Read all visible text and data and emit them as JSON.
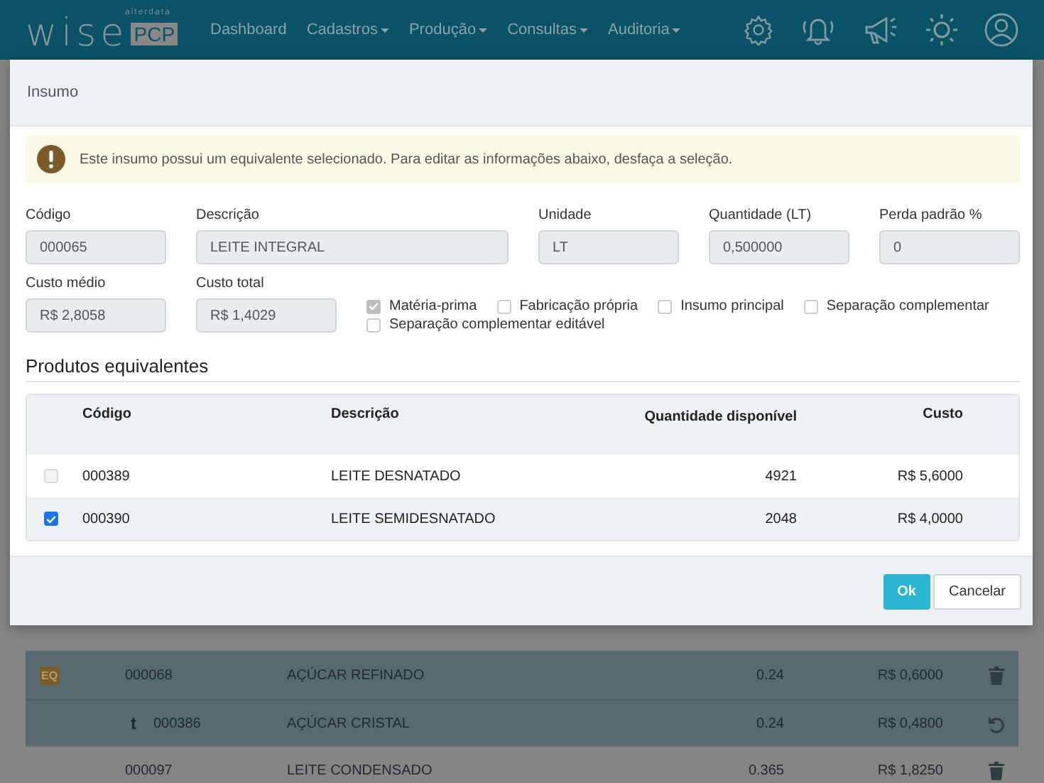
{
  "navbar": {
    "logo": "wise",
    "logo_badge": "PCP",
    "tagline": "alterdata",
    "menu": [
      {
        "label": "Dashboard",
        "dropdown": false
      },
      {
        "label": "Cadastros",
        "dropdown": true
      },
      {
        "label": "Produção",
        "dropdown": true
      },
      {
        "label": "Consultas",
        "dropdown": true
      },
      {
        "label": "Auditoria",
        "dropdown": true
      }
    ]
  },
  "background_rows": [
    {
      "kind": "equivalent",
      "badge": "EQ",
      "code": "000068",
      "description": "AÇÚCAR REFINADO",
      "quantity": "0.24",
      "cost": "R$ 0,6000"
    },
    {
      "kind": "substitute",
      "marker": "t",
      "code": "000386",
      "description": "AÇÚCAR CRISTAL",
      "quantity": "0.24",
      "cost": "R$ 0,4800"
    },
    {
      "kind": "plain",
      "code": "000097",
      "description": "LEITE CONDENSADO",
      "quantity": "0.365",
      "cost": "R$ 1,8250"
    }
  ],
  "modal": {
    "title": "Insumo",
    "alert": "Este insumo possui um equivalente selecionado. Para editar as informações abaixo, desfaça a seleção.",
    "fields_row_1": [
      {
        "label": "Código",
        "value": "000065",
        "kind": "short"
      },
      {
        "label": "Descrição",
        "value": "LEITE INTEGRAL",
        "kind": "wide"
      },
      {
        "label": "Unidade",
        "value": "LT",
        "kind": "short"
      },
      {
        "label": "Quantidade (LT)",
        "value": "0,500000",
        "kind": "short"
      },
      {
        "label": "Perda padrão %",
        "value": "0",
        "kind": "short"
      }
    ],
    "fields_row_2": [
      {
        "label": "Custo médio",
        "value": "R$ 2,8058"
      },
      {
        "label": "Custo total",
        "value": "R$ 1,4029"
      }
    ],
    "checkboxes": [
      {
        "label": "Matéria-prima",
        "checked": true,
        "disabled": true
      },
      {
        "label": "Fabricação própria",
        "checked": false,
        "disabled": false
      },
      {
        "label": "Insumo principal",
        "checked": false,
        "disabled": false
      },
      {
        "label": "Separação complementar",
        "checked": false,
        "disabled": false
      },
      {
        "label": "Separação complementar editável",
        "checked": false,
        "disabled": false
      }
    ],
    "section_title": "Produtos equivalentes",
    "table": {
      "columns": [
        "Código",
        "Descrição",
        "Quantidade disponível",
        "Custo"
      ],
      "rows": [
        {
          "selected": false,
          "code": "000389",
          "description": "LEITE DESNATADO",
          "quantity": "4921",
          "cost": "R$ 5,6000"
        },
        {
          "selected": true,
          "code": "000390",
          "description": "LEITE SEMIDESNATADO",
          "quantity": "2048",
          "cost": "R$ 4,0000"
        }
      ]
    },
    "buttons": [
      {
        "label": "Ok",
        "kind": "primary"
      },
      {
        "label": "Cancelar",
        "kind": "secondary"
      }
    ]
  }
}
